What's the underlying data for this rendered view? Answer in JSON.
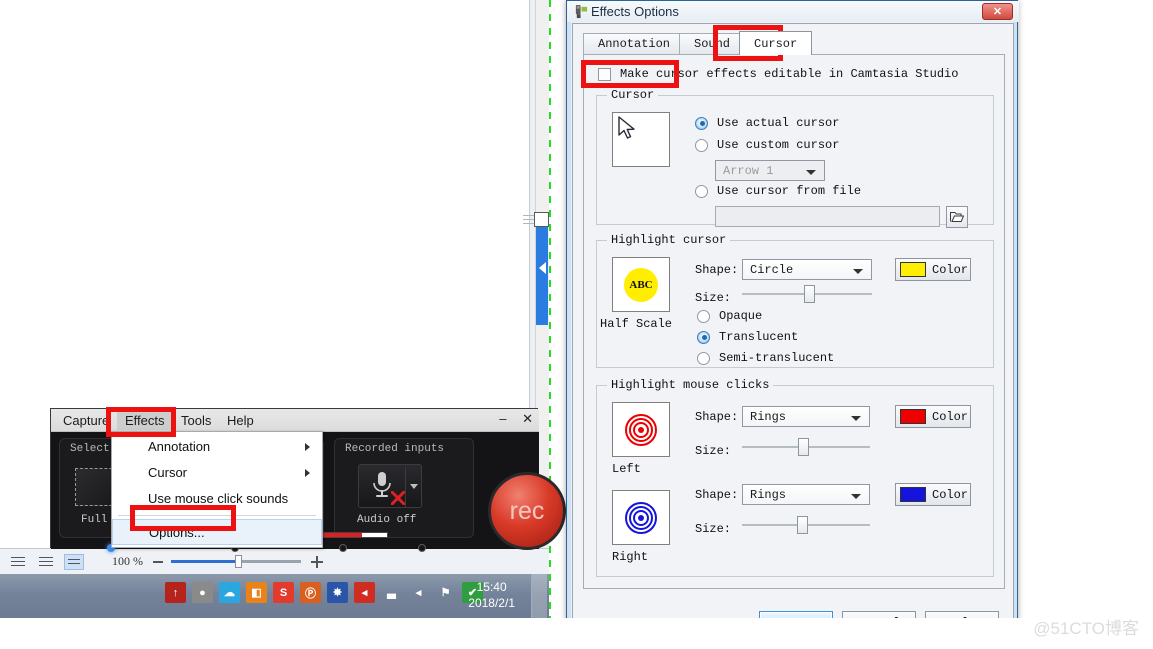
{
  "document": {
    "zoom_label": "100 %",
    "statusbar_icons": [
      "print-layout-icon",
      "outline-icon",
      "web-layout-icon"
    ]
  },
  "taskbar": {
    "time": "15:40",
    "date": "2018/2/1",
    "tray_icons": [
      {
        "name": "flash-player-icon",
        "color": "#b5231c",
        "glyph": "↑"
      },
      {
        "name": "recorder-icon",
        "color": "#8a8a8a",
        "glyph": "●"
      },
      {
        "name": "cloud-sync-icon",
        "color": "#2aa7e0",
        "glyph": "☁"
      },
      {
        "name": "office-icon",
        "color": "#e8821a",
        "glyph": "◧"
      },
      {
        "name": "sogou-input-icon",
        "color": "#e23b2e",
        "glyph": "S"
      },
      {
        "name": "pdf-reader-icon",
        "color": "#d95f1e",
        "glyph": "Ⓟ"
      },
      {
        "name": "network-globe-icon",
        "color": "#2b55a8",
        "glyph": "✸"
      },
      {
        "name": "volume-icon",
        "color": "#cf2d22",
        "glyph": "◂"
      },
      {
        "name": "signal-bars-icon",
        "color": "#ffffff",
        "glyph": "▃"
      },
      {
        "name": "speaker-icon",
        "color": "#ffffff",
        "glyph": "◂"
      },
      {
        "name": "action-center-icon",
        "color": "#ffffff",
        "glyph": "⚑"
      },
      {
        "name": "security-shield-icon",
        "color": "#2f9e3f",
        "glyph": "✔"
      }
    ]
  },
  "recorder": {
    "menus": [
      {
        "label": "Capture",
        "active": false
      },
      {
        "label": "Effects",
        "active": true
      },
      {
        "label": "Tools",
        "active": false
      },
      {
        "label": "Help",
        "active": false
      }
    ],
    "window_buttons": {
      "minimize": "–",
      "close": "✕"
    },
    "select_area_panel_title": "Select area",
    "recorded_inputs_panel_title": "Recorded inputs",
    "full_label": "Full",
    "audio_label": "Audio off",
    "rec_label": "rec"
  },
  "effects_menu": {
    "items": [
      {
        "label": "Annotation",
        "has_submenu": true,
        "highlighted": false
      },
      {
        "label": "Cursor",
        "has_submenu": true,
        "highlighted": false
      },
      {
        "label": "Use mouse click sounds",
        "has_submenu": false,
        "highlighted": false
      },
      {
        "label": "Options...",
        "has_submenu": false,
        "highlighted": true
      }
    ]
  },
  "dialog": {
    "title": "Effects Options",
    "close_glyph": "✕",
    "tabs": [
      {
        "label": "Annotation",
        "active": false
      },
      {
        "label": "Sound",
        "active": false
      },
      {
        "label": "Cursor",
        "active": true
      }
    ],
    "make_editable": {
      "label": "Make cursor effects editable in Camtasia Studio",
      "checked": false
    },
    "cursor_group": {
      "legend": "Cursor",
      "preview_icon": "mouse-pointer-icon",
      "options": [
        {
          "label": "Use actual cursor",
          "selected": true
        },
        {
          "label": "Use custom cursor",
          "selected": false
        },
        {
          "label": "Use cursor from file",
          "selected": false
        }
      ],
      "custom_cursor_value": "Arrow 1",
      "file_path_value": "",
      "browse_icon": "folder-open-icon"
    },
    "highlight_cursor_group": {
      "legend": "Highlight cursor",
      "preview_text": "ABC",
      "preview_caption": "Half Scale",
      "preview_color": "#ffee00",
      "shape_label": "Shape:",
      "shape_value": "Circle",
      "size_label": "Size:",
      "size_percent": 52,
      "color_button_label": "Color",
      "color_value": "#ffee00",
      "opacity_options": [
        {
          "label": "Opaque",
          "selected": false
        },
        {
          "label": "Translucent",
          "selected": true
        },
        {
          "label": "Semi-translucent",
          "selected": false
        }
      ]
    },
    "highlight_clicks_group": {
      "legend": "Highlight mouse clicks",
      "rows": [
        {
          "caption": "Left",
          "preview_icon": "concentric-rings-icon",
          "shape_label": "Shape:",
          "shape_value": "Rings",
          "size_label": "Size:",
          "size_percent": 48,
          "color_button_label": "Color",
          "color_value": "#ee0000"
        },
        {
          "caption": "Right",
          "preview_icon": "concentric-rings-icon",
          "shape_label": "Shape:",
          "shape_value": "Rings",
          "size_label": "Size:",
          "size_percent": 47,
          "color_button_label": "Color",
          "color_value": "#1414dd"
        }
      ]
    },
    "buttons": [
      {
        "label": "OK",
        "default": true
      },
      {
        "label": "Cancel",
        "default": false
      },
      {
        "label": "Help",
        "default": false
      }
    ]
  },
  "watermark": "@51CTO博客",
  "annotation_color": "#ee1111"
}
